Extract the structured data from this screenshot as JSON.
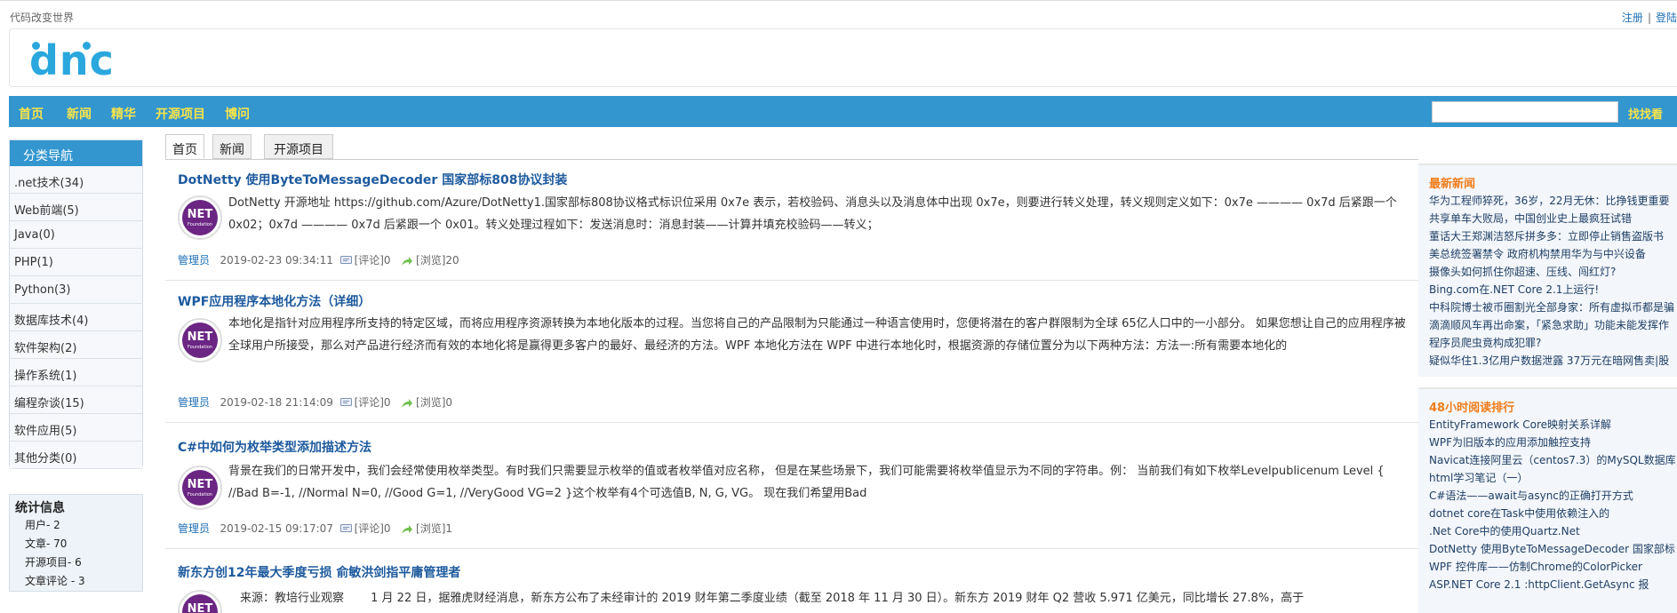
{
  "header": {
    "slogan": "代码改变世界",
    "register": "注册",
    "separator": "|",
    "login": "登陆",
    "logo_text": "dnc"
  },
  "nav": {
    "items": [
      "首页",
      "新闻",
      "精华",
      "开源项目",
      "博问"
    ],
    "search_placeholder": "",
    "search_button": "找找看"
  },
  "sidebar": {
    "category_title": "分类导航",
    "categories": [
      ".net技术(34)",
      "Web前端(5)",
      "Java(0)",
      "PHP(1)",
      "Python(3)",
      "数据库技术(4)",
      "软件架构(2)",
      "操作系统(1)",
      "编程杂谈(15)",
      "软件应用(5)",
      "其他分类(0)"
    ],
    "stats_title": "统计信息",
    "stats": [
      "用户- 2",
      "文章- 70",
      "开源项目- 6",
      "文章评论 - 3"
    ]
  },
  "tabs": [
    "首页",
    "新闻",
    "开源项目"
  ],
  "articles": [
    {
      "title": "DotNetty 使用ByteToMessageDecoder 国家部标808协议封装",
      "summary": "DotNetty 开源地址 https://github.com/Azure/DotNetty1.国家部标808协议格式标识位采用 0x7e 表示，若校验码、消息头以及消息体中出现 0x7e，则要进行转义处理，转义规则定义如下：0x7e ———— 0x7d 后紧跟一个 0x02；0x7d ———— 0x7d 后紧跟一个 0x01。转义处理过程如下：发送消息时：消息封装——计算并填充校验码——转义；",
      "author": "管理员",
      "date": "2019-02-23 09:34:11",
      "comments": "[评论]0",
      "views": "[浏览]20"
    },
    {
      "title": "WPF应用程序本地化方法（详细）",
      "summary": "本地化是指针对应用程序所支持的特定区域，而将应用程序资源转换为本地化版本的过程。当您将自己的产品限制为只能通过一种语言使用时，您便将潜在的客户群限制为全球 65亿人口中的一小部分。 如果您想让自己的应用程序被全球用户所接受，那么对产品进行经济而有效的本地化将是赢得更多客户的最好、最经济的方法。WPF 本地化方法在 WPF 中进行本地化时，根据资源的存储位置分为以下两种方法：方法一:所有需要本地化的",
      "author": "管理员",
      "date": "2019-02-18 21:14:09",
      "comments": "[评论]0",
      "views": "[浏览]0"
    },
    {
      "title": "C#中如何为枚举类型添加描述方法",
      "summary": "背景在我们的日常开发中，我们会经常使用枚举类型。有时我们只需要显示枚举的值或者枚举值对应名称， 但是在某些场景下，我们可能需要将枚举值显示为不同的字符串。例： 当前我们有如下枚举Levelpublicenum Level { //Bad B=-1, //Normal N=0, //Good G=1, //VeryGood VG=2 }这个枚举有4个可选值B, N, G, VG。 现在我们希望用Bad",
      "author": "管理员",
      "date": "2019-02-15 09:17:07",
      "comments": "[评论]0",
      "views": "[浏览]1"
    },
    {
      "title": "新东方创12年最大季度亏损 俞敏洪剑指平庸管理者",
      "summary": "来源：教培行业观察 　　1 月 22 日，据雅虎财经消息，新东方公布了未经审计的 2019 财年第二季度业绩（截至 2018 年 11 月 30 日）。新东方 2019 财年 Q2 营收 5.971 亿美元，同比增长 27.8%，高于"
    }
  ],
  "icon_text": {
    "big": "NET",
    "small": "Foundation"
  },
  "right": {
    "news_title": "最新新闻",
    "news": [
      "华为工程师猝死，36岁，22月无休：比挣钱更重要",
      "共享单车大败局，中国创业史上最疯狂试错",
      "董话大王郑渊洁怒斥拼多多：立即停止销售盗版书",
      "美总统签署禁令 政府机构禁用华为与中兴设备",
      "摄像头如何抓住你超速、压线、闯红灯?",
      "Bing.com在.NET Core 2.1上运行!",
      "中科院博士被币圈割光全部身家：所有虚拟币都是骗",
      "滴滴顺风车再出命案，「紧急求助」功能未能发挥作",
      "程序员爬虫竟构成犯罪?",
      "疑似华住1.3亿用户数据泄露 37万元在暗网售卖|股"
    ],
    "hot_title": "48小时阅读排行",
    "hot": [
      "EntityFramework Core映射关系详解",
      "WPF为旧版本的应用添加触控支持",
      "Navicat连接阿里云（centos7.3）的MySQL数据库",
      "html学习笔记（一）",
      "C#语法——await与async的正确打开方式",
      "dotnet core在Task中使用依赖注入的",
      ".Net Core中的使用Quartz.Net",
      "DotNetty 使用ByteToMessageDecoder 国家部标",
      "WPF 控件库——仿制Chrome的ColorPicker",
      "ASP.NET Core 2.1 :httpClient.GetAsync 报"
    ]
  },
  "colors": {
    "nav_bg": "#3396cf",
    "nav_text": "#f7e34b",
    "title_link": "#1d5a9e",
    "right_heading": "#f07d1a",
    "logo": "#2aa7dd"
  }
}
